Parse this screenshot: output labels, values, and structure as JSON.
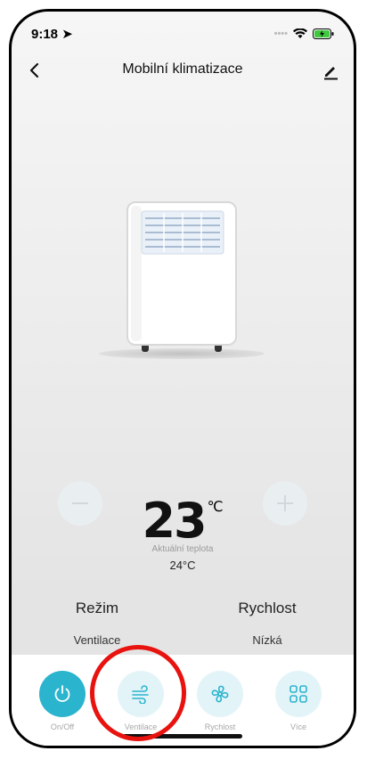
{
  "status": {
    "time": "9:18"
  },
  "nav": {
    "title": "Mobilní klimatizace",
    "back_icon": "chevron-left-icon",
    "edit_icon": "pencil-icon"
  },
  "temperature": {
    "set": "23",
    "unit": "℃",
    "current_label": "Aktuální teplota",
    "current_value": "24°C"
  },
  "mode": {
    "label": "Režim",
    "value": "Ventilace"
  },
  "speed": {
    "label": "Rychlost",
    "value": "Nízká"
  },
  "bottom_bar": [
    {
      "label": "On/Off",
      "icon": "power-icon"
    },
    {
      "label": "Ventilace",
      "icon": "wind-icon"
    },
    {
      "label": "Rychlost",
      "icon": "fan-icon"
    },
    {
      "label": "Více",
      "icon": "grid-icon"
    }
  ],
  "colors": {
    "accent": "#2bb4ce",
    "icon_bg": "#e3f4f8",
    "annotation": "#e8120f"
  }
}
